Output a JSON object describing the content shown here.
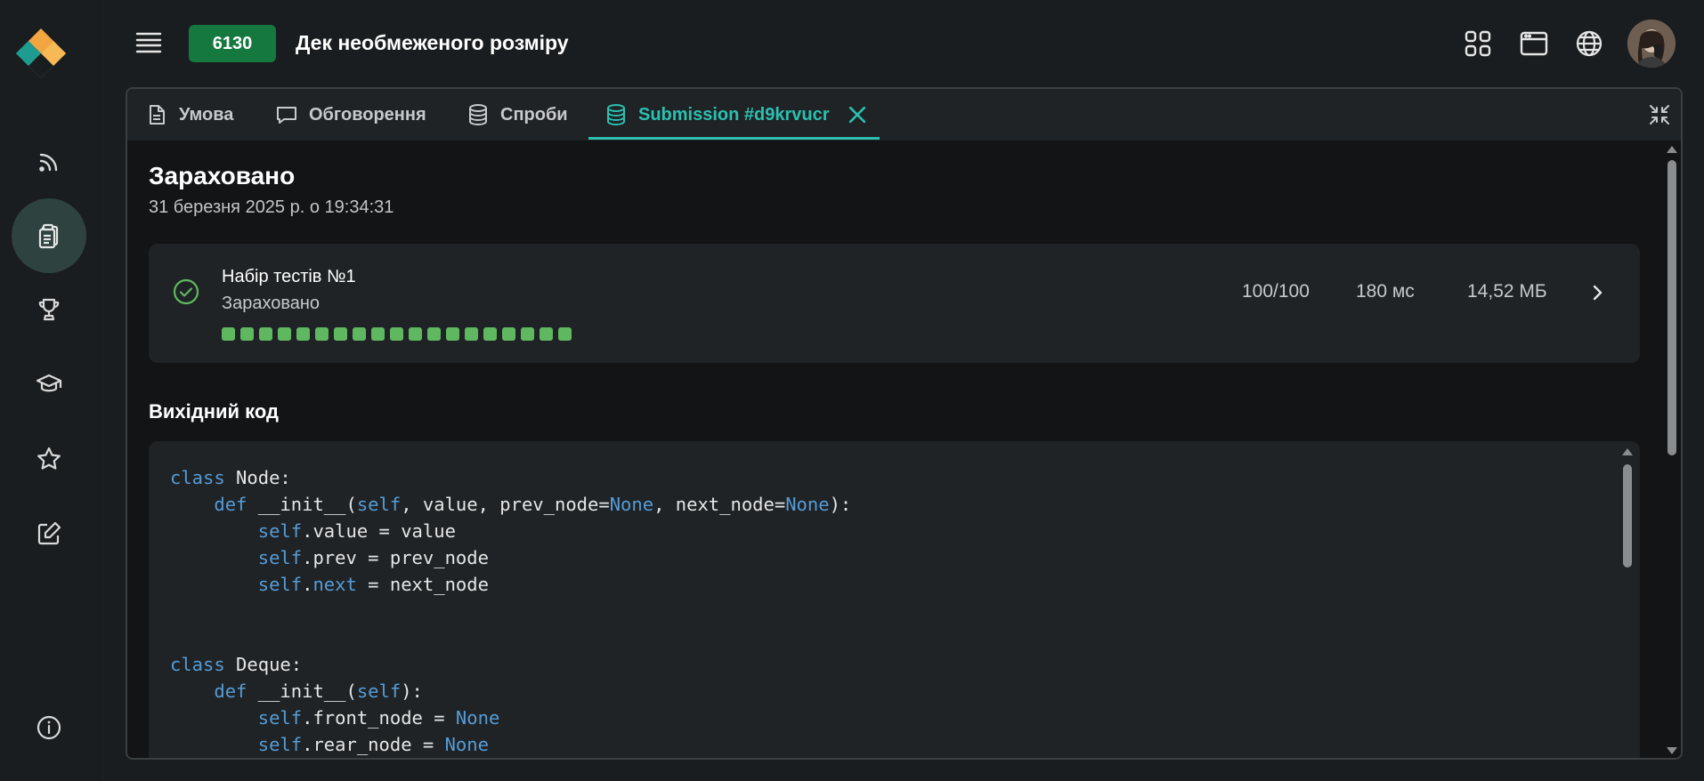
{
  "sidebar": {
    "icons": [
      "feed-icon",
      "submissions-icon",
      "trophy-icon",
      "courses-icon",
      "favorites-icon",
      "edit-icon",
      "info-icon"
    ]
  },
  "header": {
    "problem_id": "6130",
    "title": "Дек необмеженого розміру"
  },
  "tabs": [
    {
      "label": "Умова",
      "icon": "document-icon"
    },
    {
      "label": "Обговорення",
      "icon": "chat-icon"
    },
    {
      "label": "Спроби",
      "icon": "database-icon"
    },
    {
      "label": "Submission #d9krvucr",
      "icon": "database-icon",
      "active": true
    }
  ],
  "result": {
    "verdict": "Зараховано",
    "date": "31 березня 2025 р. о 19:34:31"
  },
  "test_set": {
    "name": "Набір тестів №1",
    "status": "Зараховано",
    "tests_passed": 19,
    "score": "100/100",
    "time": "180 мс",
    "memory": "14,52 МБ"
  },
  "source": {
    "heading": "Вихідний код",
    "lines": [
      "class Node:",
      "    def __init__(self, value, prev_node=None, next_node=None):",
      "        self.value = value",
      "        self.prev = prev_node",
      "        self.next = next_node",
      "",
      "",
      "class Deque:",
      "    def __init__(self):",
      "        self.front_node = None",
      "        self.rear_node = None"
    ]
  },
  "colors": {
    "accent": "#2bc0b0",
    "badge": "#14783f",
    "success": "#5fb85f",
    "keyword": "#569cd6"
  }
}
